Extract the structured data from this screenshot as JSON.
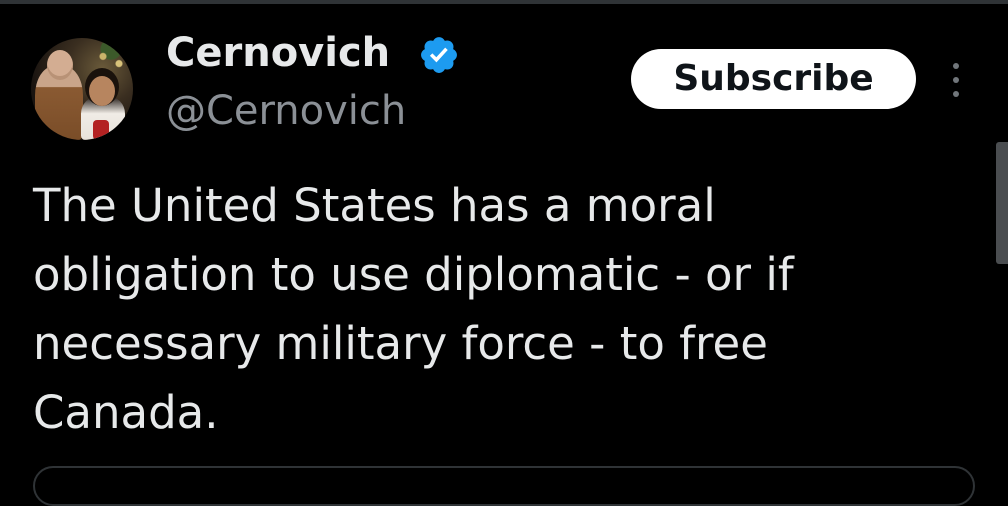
{
  "tweet": {
    "author": {
      "display_name": "Cernovich",
      "handle": "@Cernovich",
      "verified": true,
      "avatar_icon": "avatar-photo"
    },
    "subscribe_label": "Subscribe",
    "more_icon": "more-vertical-icon",
    "text_lines": [
      "The United States has a moral",
      "obligation to use diplomatic - or if",
      "necessary military force - to free",
      "Canada."
    ]
  },
  "colors": {
    "background": "#000000",
    "text_primary": "#e7e9ea",
    "text_secondary": "#8b9096",
    "verified_blue": "#1d9bf0",
    "button_bg": "#ffffff",
    "button_text": "#0f1419",
    "divider": "#2f3336"
  }
}
